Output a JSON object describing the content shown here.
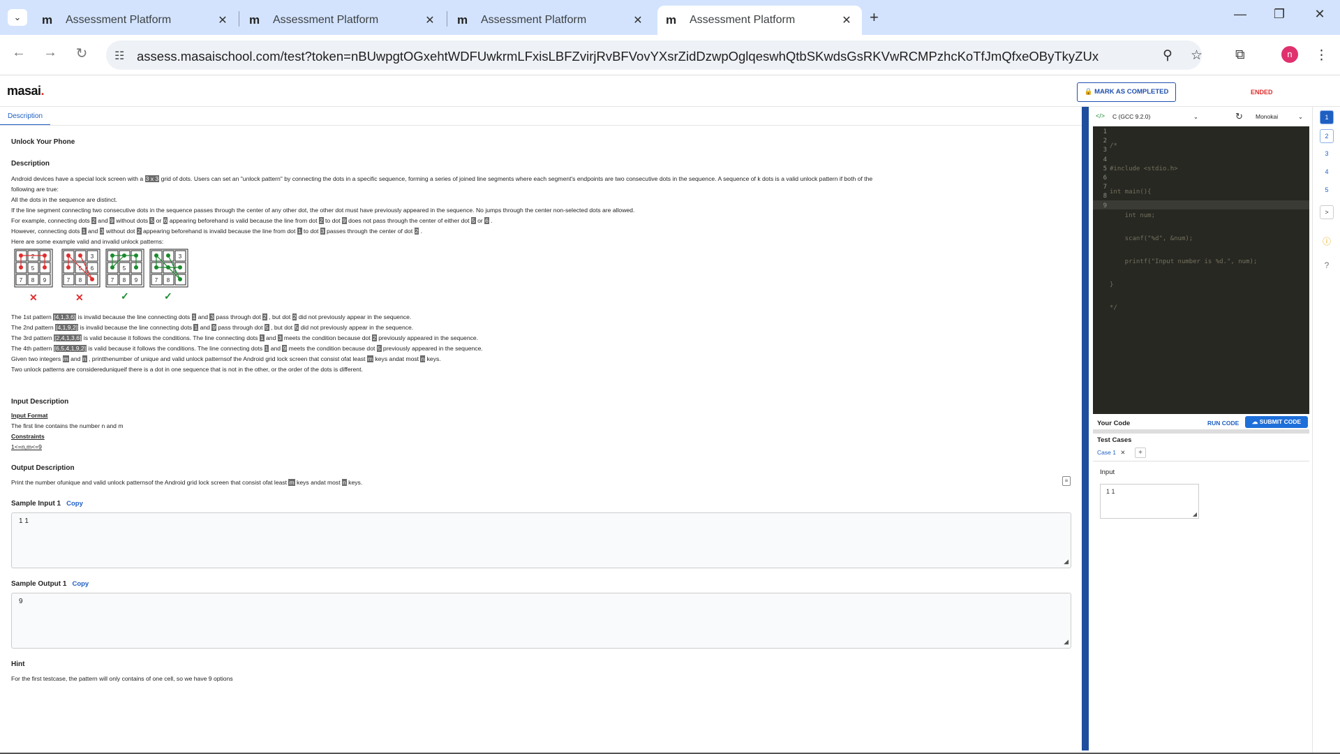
{
  "browser": {
    "tabs": [
      {
        "title": "Assessment Platform",
        "favicon": "m"
      },
      {
        "title": "Assessment Platform",
        "favicon": "m"
      },
      {
        "title": "Assessment Platform",
        "favicon": "m"
      },
      {
        "title": "Assessment Platform",
        "favicon": "m"
      }
    ],
    "active_tab": 3,
    "url": "assess.masaischool.com/test?token=nBUwpgtOGxehtWDFUwkrmLFxisLBFZvirjRvBFVovYXsrZidDzwpOglqeswhQtbSKwdsGsRKVwRCMPzhcKoTfJmQfxeOByTkyZUx",
    "profile_initial": "n"
  },
  "app": {
    "logo": "masai",
    "mark_completed": "MARK AS COMPLETED",
    "status": "ENDED"
  },
  "problem": {
    "tab": "Description",
    "title": "Unlock Your Phone",
    "description_heading": "Description",
    "lines": [
      "Android devices have a special lock screen with a 3 x 3 grid of dots. Users can set an \"unlock pattern\" by connecting the dots in a specific sequence, forming a series of joined line segments where each segment's endpoints are two consecutive dots in the sequence. A sequence of k dots is a valid unlock pattern if both of the",
      "following are true:",
      "All the dots in the sequence are distinct.",
      "If the line segment connecting two consecutive dots in the sequence passes through the center of any other dot, the other dot must have previously appeared in the sequence. No jumps through the center non-selected dots are allowed.",
      "Here are some example valid and invalid unlock patterns:"
    ],
    "pattern_marks": [
      "✕",
      "✕",
      "✓",
      "✓"
    ],
    "pattern_lines": [
      "The 1st pattern [4,1,3,6] is invalid because the line connecting dots 1 and 3 pass through dot 2 , but dot 2 did not previously appear in the sequence.",
      "The 2nd pattern [4,1,9,2] is invalid because the line connecting dots 1 and 9 pass through dot 5 , but dot 5 did not previously appear in the sequence.",
      "The 3rd pattern [2,4,1,3,6] is valid because it follows the conditions. The line connecting dots 1 and 3 meets the condition because dot 2 previously appeared in the sequence.",
      "The 4th pattern [6,5,4,1,9,2] is valid because it follows the conditions. The line connecting dots 1 and 9 meets the condition because dot 5 previously appeared in the sequence.",
      "Given two integers m and n , printthenumber of unique and valid unlock patternsof the Android grid lock screen that consist ofat least m keys andat most n keys.",
      "Two unlock patterns are considereduniqueif there is a dot in one sequence that is not in the other, or the order of the dots is different."
    ],
    "input_heading": "Input Description",
    "input_format_label": "Input Format",
    "input_format_text": "The first line contains the number n and m",
    "constraints_label": "Constraints",
    "constraints_text": "1<=n,m<=9",
    "output_heading": "Output Description",
    "output_text": "Print the number ofunique and valid unlock patternsof the Android grid lock screen that consist ofat least m keys andat most n keys.",
    "sample_input_label": "Sample Input 1",
    "sample_input_value": "1 1",
    "sample_output_label": "Sample Output 1",
    "sample_output_value": "9",
    "copy_label": "Copy",
    "hint_heading": "Hint",
    "hint_text": "For the first testcase, the pattern will only contains of one cell, so we have 9 options"
  },
  "editor": {
    "language": "C (GCC 9.2.0)",
    "theme": "Monokai",
    "code_lines": [
      "/*",
      "#include <stdio.h>",
      "int main(){",
      "    int num;",
      "    scanf(\"%d\", &num);",
      "    printf(\"Input number is %d.\", num);",
      "}",
      "*/",
      ""
    ],
    "your_code": "Your Code",
    "run": "RUN CODE",
    "submit": "SUBMIT CODE",
    "test_cases_heading": "Test Cases",
    "case_label": "Case 1",
    "input_label": "Input",
    "input_value": "1 1"
  },
  "rail": {
    "items": [
      "1",
      "2",
      "3",
      "4",
      "5"
    ],
    "next": ">"
  },
  "colors": {
    "accent": "#1e5fc2",
    "divider": "#1f4e9e",
    "status": "#e02e2e",
    "valid": "#1a8a2e",
    "invalid": "#e02e2e"
  }
}
